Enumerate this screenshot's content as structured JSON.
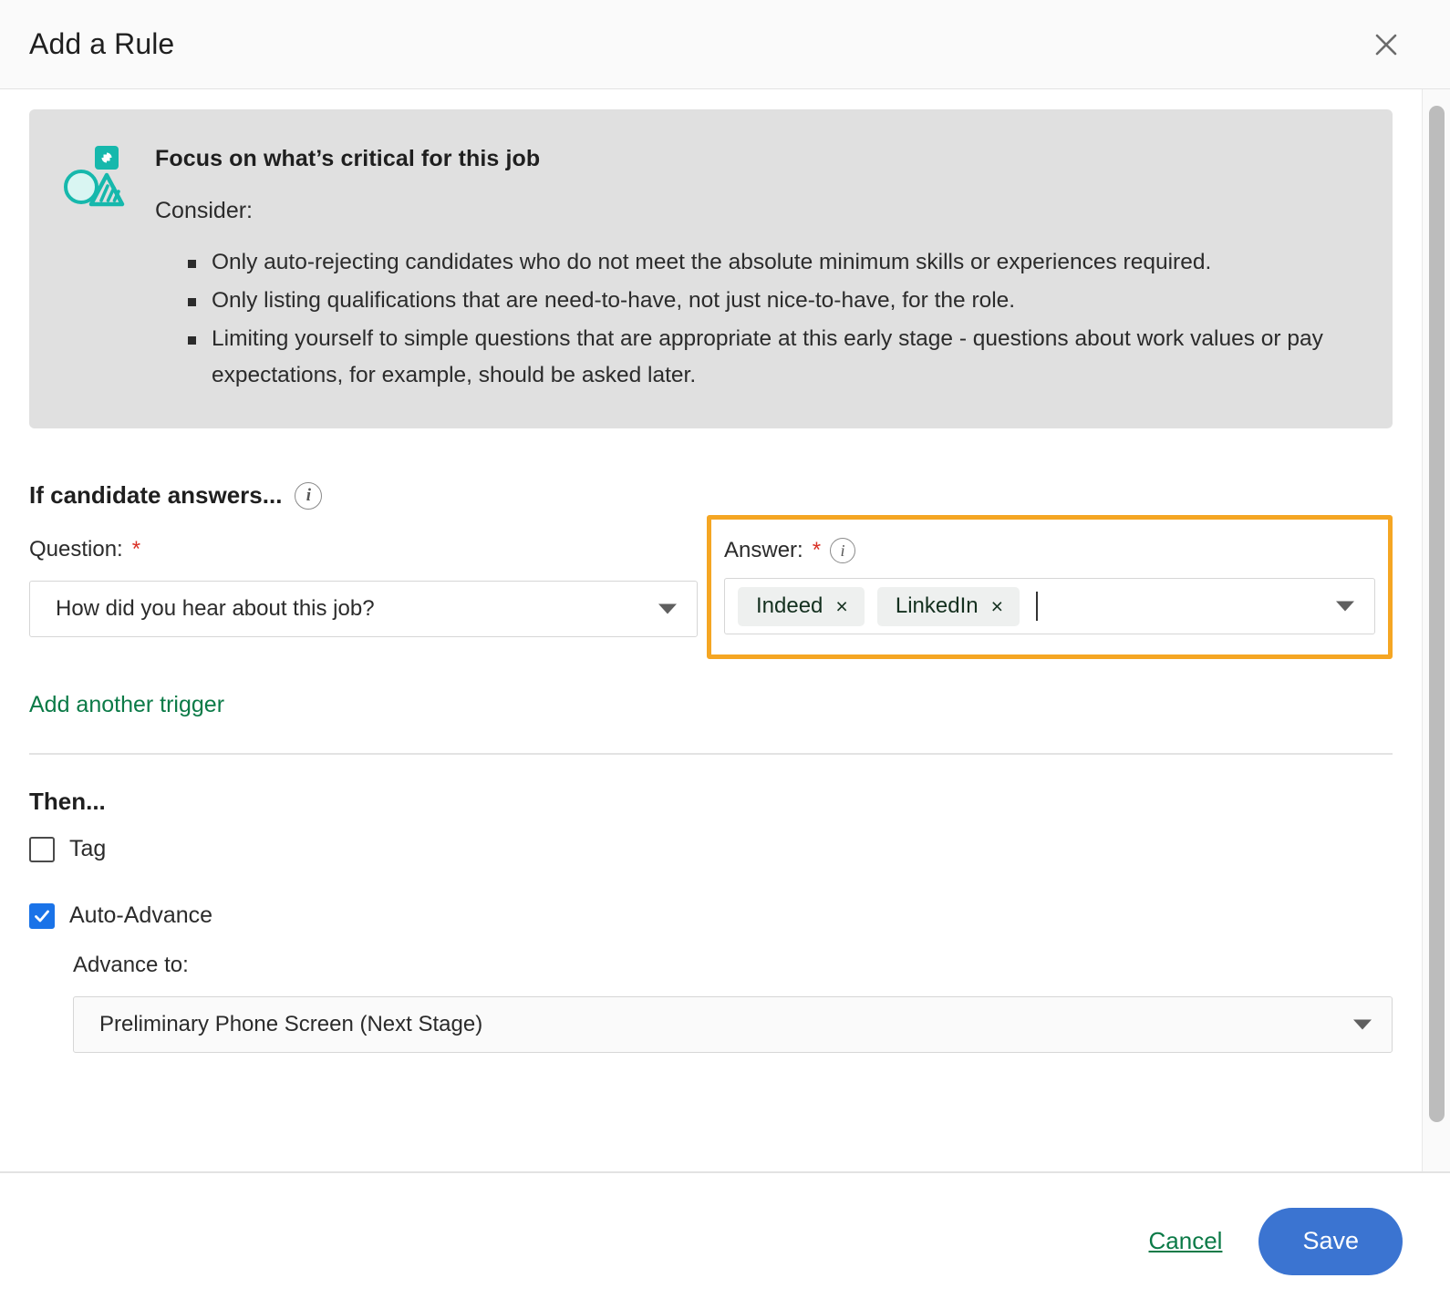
{
  "header": {
    "title": "Add a Rule",
    "close_label": "×"
  },
  "callout": {
    "heading": "Focus on what’s critical for this job",
    "subheading": "Consider:",
    "bullets": [
      "Only auto-rejecting candidates who do not meet the absolute minimum skills or experiences required.",
      "Only listing qualifications that are need-to-have, not just nice-to-have, for the role.",
      "Limiting yourself to simple questions that are appropriate at this early stage - questions about work values or pay expectations, for example, should be asked later."
    ]
  },
  "trigger": {
    "section_title": "If candidate answers...",
    "info_glyph": "i",
    "question_label": "Question:",
    "required_mark": "*",
    "question_value": "How did you hear about this job?",
    "answer_label": "Answer:",
    "answer_chips": [
      {
        "label": "Indeed",
        "remove": "×"
      },
      {
        "label": "LinkedIn",
        "remove": "×"
      }
    ],
    "add_trigger_link": "Add another trigger"
  },
  "then": {
    "section_title": "Then...",
    "tag_label": "Tag",
    "tag_checked": false,
    "auto_advance_label": "Auto-Advance",
    "auto_advance_checked": true,
    "advance_to_label": "Advance to:",
    "advance_to_value": "Preliminary Phone Screen (Next Stage)"
  },
  "footer": {
    "cancel_label": "Cancel",
    "save_label": "Save"
  },
  "colors": {
    "highlight_orange": "#f5a623",
    "accent_teal": "#16b8ac",
    "link_green": "#0b7a47",
    "save_blue": "#3b74d1",
    "checkbox_blue": "#1a73e8",
    "required_red": "#d93025",
    "callout_gray": "#e0e0e0"
  }
}
